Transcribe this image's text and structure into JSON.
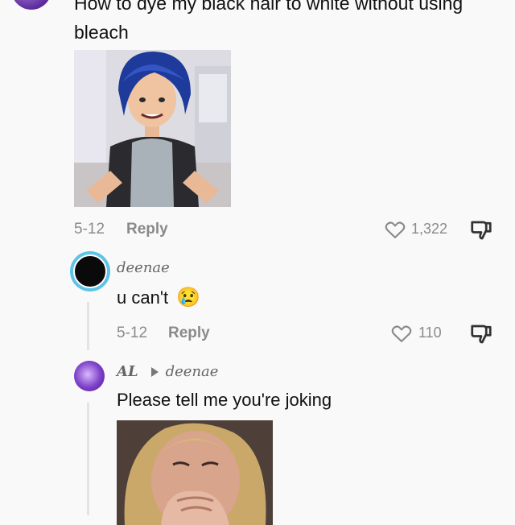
{
  "top_comment": {
    "text": "How to dye my black hair to white without using bleach",
    "date": "5-12",
    "reply_label": "Reply",
    "likes": "1,322"
  },
  "reply1": {
    "username": "deenae",
    "text": "u can't",
    "emoji": "😢",
    "date": "5-12",
    "reply_label": "Reply",
    "likes": "110"
  },
  "reply2": {
    "username": "AL",
    "reply_to": "deenae",
    "text": "Please tell me you're joking"
  },
  "icons": {
    "like": "heart-outline-icon",
    "dislike": "thumbs-down-icon",
    "reply_arrow": "triangle-right-icon"
  },
  "colors": {
    "background": "#f9f9f9",
    "muted_text": "#8a8a8a",
    "avatar_ring": "#5ec3e8"
  }
}
